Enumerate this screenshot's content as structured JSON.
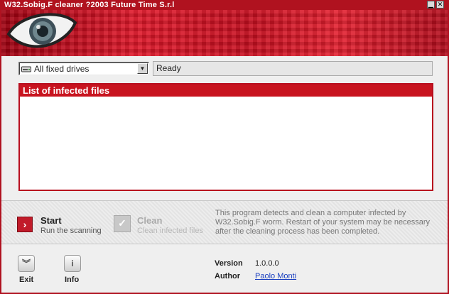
{
  "window": {
    "title": "W32.Sobig.F cleaner ?2003 Future Time S.r.l",
    "minimize_icon": "minimize-icon",
    "close_icon": "close-icon"
  },
  "banner": {
    "logo_icon": "eye-logo-icon"
  },
  "drive_select": {
    "icon": "drive-icon",
    "selected": "All fixed drives"
  },
  "status": {
    "text": "Ready"
  },
  "infected_list": {
    "header": "List of infected files",
    "items": []
  },
  "actions": {
    "start": {
      "title": "Start",
      "subtitle": "Run the scanning",
      "icon": "chevron-right-icon"
    },
    "clean": {
      "title": "Clean",
      "subtitle": "Clean infected files",
      "icon": "checkmark-icon",
      "enabled": false
    },
    "description": "This program detects and clean a computer infected by W32.Sobig.F worm. Restart of your system may be necessary after the cleaning process has been completed."
  },
  "footer": {
    "exit_label": "Exit",
    "exit_icon": "double-chevron-down-icon",
    "info_label": "Info",
    "info_icon": "info-icon",
    "version_label": "Version",
    "version_value": "1.0.0.0",
    "author_label": "Author",
    "author_value": "Paolo Monti"
  },
  "colors": {
    "accent": "#c8141f",
    "title_bar": "#b0121f",
    "link": "#1a3fc0"
  }
}
